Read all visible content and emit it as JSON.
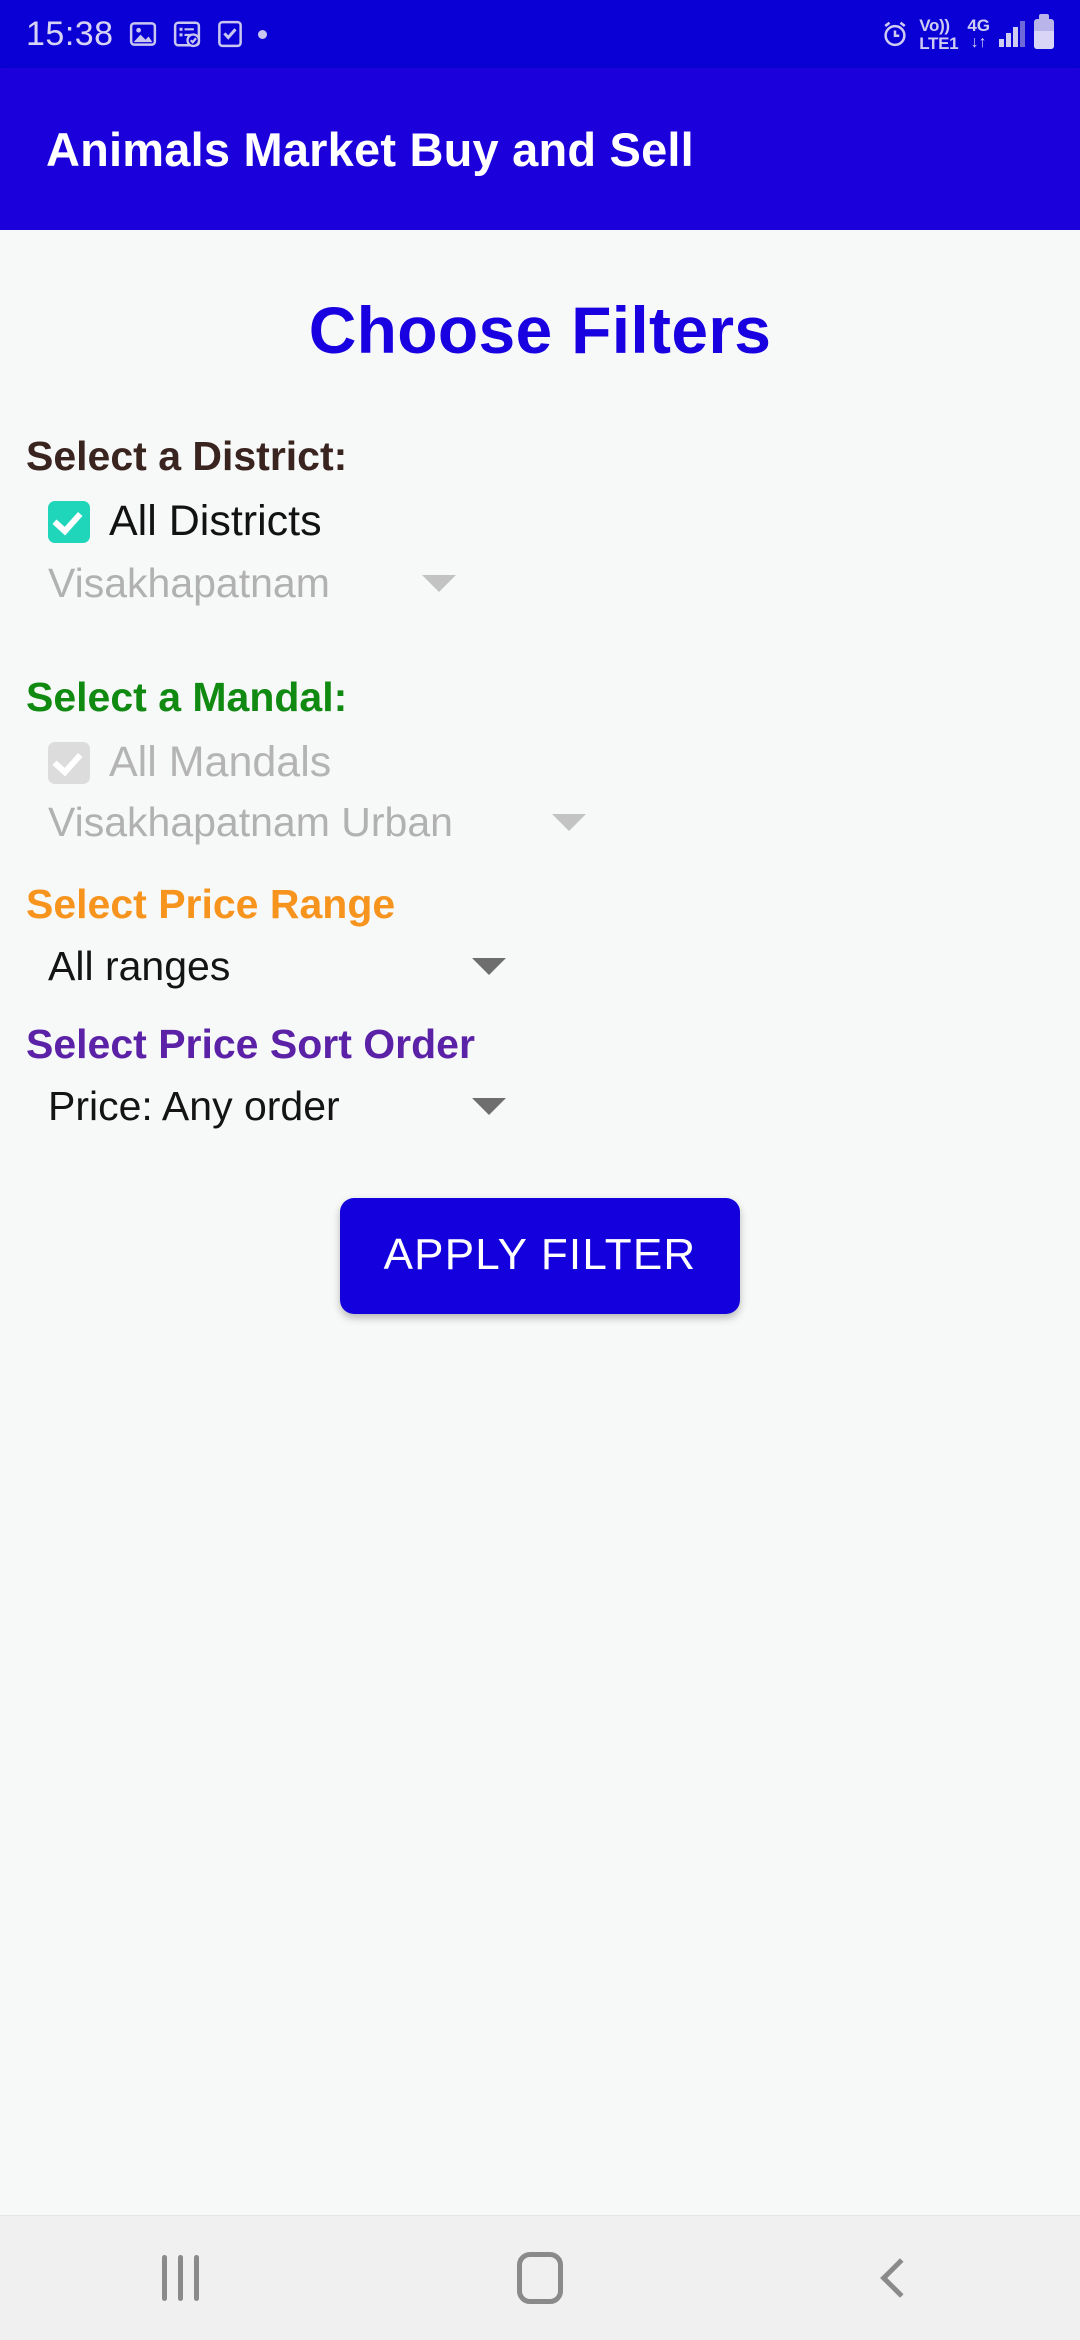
{
  "status_bar": {
    "time": "15:38",
    "left_icons": [
      "gallery-icon",
      "notes-check-icon",
      "task-check-icon",
      "dot-indicator"
    ],
    "volte_line1": "Vo))",
    "volte_line2": "LTE1",
    "network_type": "4G",
    "data_arrows": "↓↑",
    "right_icons": [
      "alarm-icon",
      "volte-icon",
      "signal-icon",
      "battery-icon"
    ],
    "background_color": "#0a00d6"
  },
  "app_bar": {
    "title": "Animals Market Buy and Sell",
    "background_color": "#1b00db"
  },
  "page": {
    "title": "Choose Filters",
    "title_color": "#1800e0",
    "background_color": "#f7f8f8"
  },
  "district_section": {
    "label": "Select a District:",
    "label_color": "#3a2420",
    "checkbox_label": "All Districts",
    "checkbox_checked": true,
    "checkbox_enabled": true,
    "checkbox_color": "#1fd6bb",
    "dropdown_value": "Visakhapatnam",
    "dropdown_enabled": false
  },
  "mandal_section": {
    "label": "Select a Mandal:",
    "label_color": "#108a10",
    "checkbox_label": "All Mandals",
    "checkbox_checked": true,
    "checkbox_enabled": false,
    "checkbox_color": "#dcdcdc",
    "dropdown_value": "Visakhapatnam Urban",
    "dropdown_enabled": false
  },
  "price_range_section": {
    "label": "Select Price Range",
    "label_color": "#f7941e",
    "dropdown_value": "All ranges",
    "dropdown_enabled": true
  },
  "sort_order_section": {
    "label": "Select Price Sort Order",
    "label_color": "#5b21a6",
    "dropdown_value": "Price: Any order",
    "dropdown_enabled": true
  },
  "apply_button": {
    "label": "APPLY FILTER",
    "background_color": "#1400dd",
    "text_color": "#ffffff"
  },
  "nav_bar": {
    "recents_label": "recents-button",
    "home_label": "home-button",
    "back_label": "back-button",
    "background_color": "#f0f0f0"
  }
}
